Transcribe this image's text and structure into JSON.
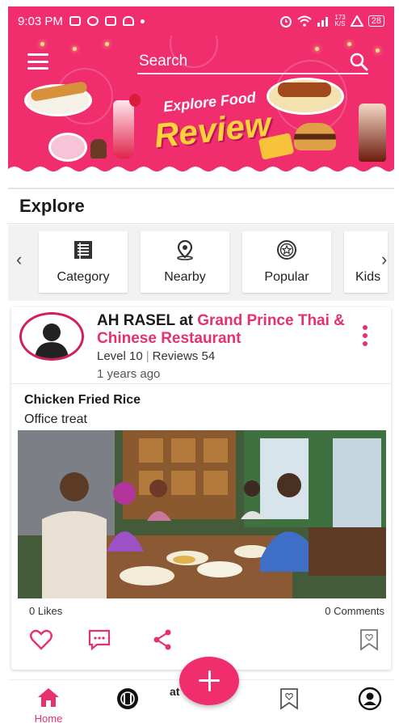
{
  "status_bar": {
    "time": "9:03 PM",
    "network_label": "173\nK/S",
    "battery": "28"
  },
  "header": {
    "search_placeholder": "Search",
    "banner_line1": "Explore Food",
    "banner_line2": "Review"
  },
  "explore": {
    "title": "Explore",
    "categories": [
      {
        "label": "Category",
        "icon": "list-icon"
      },
      {
        "label": "Nearby",
        "icon": "location-pin-icon"
      },
      {
        "label": "Popular",
        "icon": "star-badge-icon"
      },
      {
        "label": "Kids",
        "icon": "kids-icon"
      }
    ]
  },
  "post": {
    "author": "AH RASEL",
    "at": "at",
    "restaurant": "Grand Prince Thai & Chinese Restaurant",
    "level_label": "Level",
    "level_value": "10",
    "reviews_label": "Reviews",
    "reviews_value": "54",
    "time_ago": "1 years ago",
    "title": "Chicken Fried Rice",
    "description": "Office treat",
    "likes": "0 Likes",
    "comments": "0 Comments"
  },
  "bottom_nav": {
    "home_label": "Home",
    "partial_text": "at Gr"
  },
  "colors": {
    "brand": "#f02e6e",
    "accent_text": "#e5316e",
    "banner_yellow": "#ffd23a"
  }
}
